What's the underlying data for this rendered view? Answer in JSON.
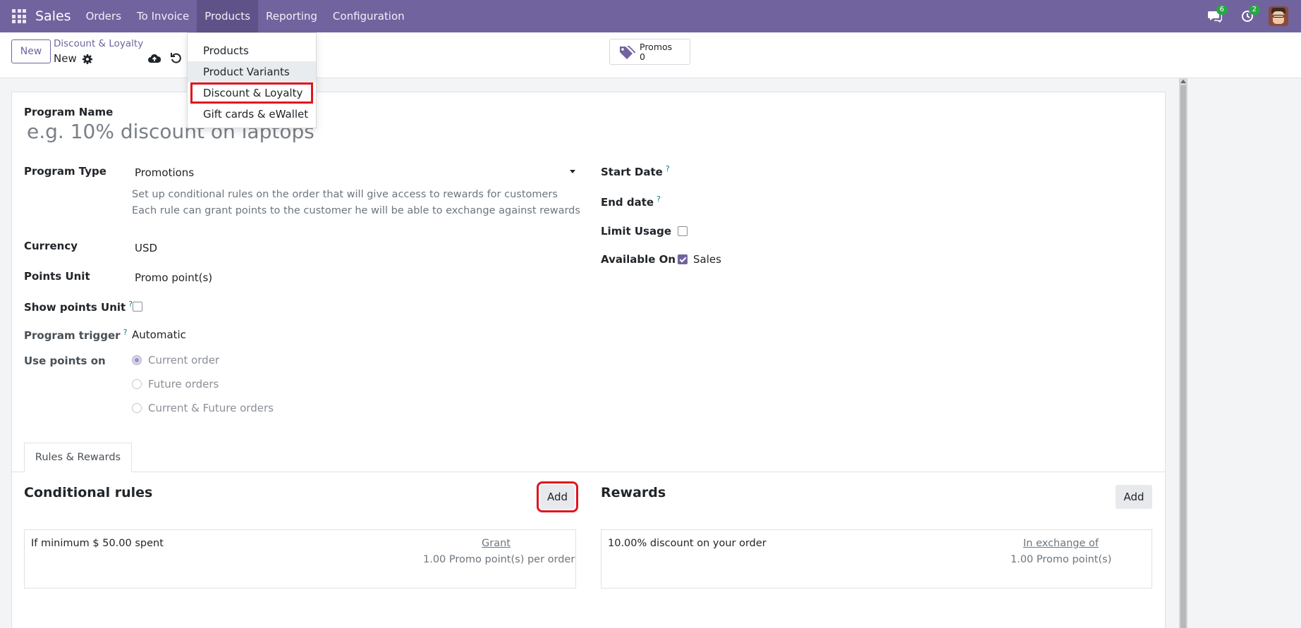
{
  "navbar": {
    "brand": "Sales",
    "menu": [
      "Orders",
      "To Invoice",
      "Products",
      "Reporting",
      "Configuration"
    ],
    "active_menu": "Products",
    "messages_count": "6",
    "activities_count": "2"
  },
  "control_panel": {
    "new_label": "New",
    "breadcrumb": "Discount & Loyalty",
    "record_name": "New",
    "stat_label": "Promos",
    "stat_value": "0"
  },
  "products_dropdown": {
    "items": [
      "Products",
      "Product Variants",
      "Discount & Loyalty",
      "Gift cards & eWallet"
    ]
  },
  "form": {
    "program_name_label": "Program Name",
    "program_name_placeholder": "e.g. 10% discount on laptops",
    "program_type_label": "Program Type",
    "program_type_value": "Promotions",
    "program_type_desc_1": "Set up conditional rules on the order that will give access to rewards for customers",
    "program_type_desc_2": "Each rule can grant points to the customer he will be able to exchange against rewards",
    "currency_label": "Currency",
    "currency_value": "USD",
    "points_unit_label": "Points Unit",
    "points_unit_value": "Promo point(s)",
    "show_points_unit_label": "Show points Unit",
    "program_trigger_label": "Program trigger",
    "program_trigger_value": "Automatic",
    "use_points_on_label": "Use points on",
    "use_points_options": [
      "Current order",
      "Future orders",
      "Current & Future orders"
    ],
    "use_points_selected": "Current order",
    "start_date_label": "Start Date",
    "end_date_label": "End date",
    "limit_usage_label": "Limit Usage",
    "available_on_label": "Available On",
    "available_on_sales": "Sales",
    "help_mark": "?"
  },
  "tabs": {
    "rules_rewards": "Rules & Rewards"
  },
  "rules": {
    "title": "Conditional rules",
    "add_label": "Add",
    "card_text": "If minimum $ 50.00 spent",
    "grant_label": "Grant",
    "grant_value": "1.00 Promo point(s) per order"
  },
  "rewards": {
    "title": "Rewards",
    "add_label": "Add",
    "card_text": "10.00% discount on your order",
    "exchange_label": "In exchange of",
    "exchange_value": "1.00 Promo point(s)"
  },
  "colors": {
    "navbar": "#71639e",
    "accent": "#71639e",
    "highlight": "#e0151e",
    "badge": "#28a745"
  }
}
